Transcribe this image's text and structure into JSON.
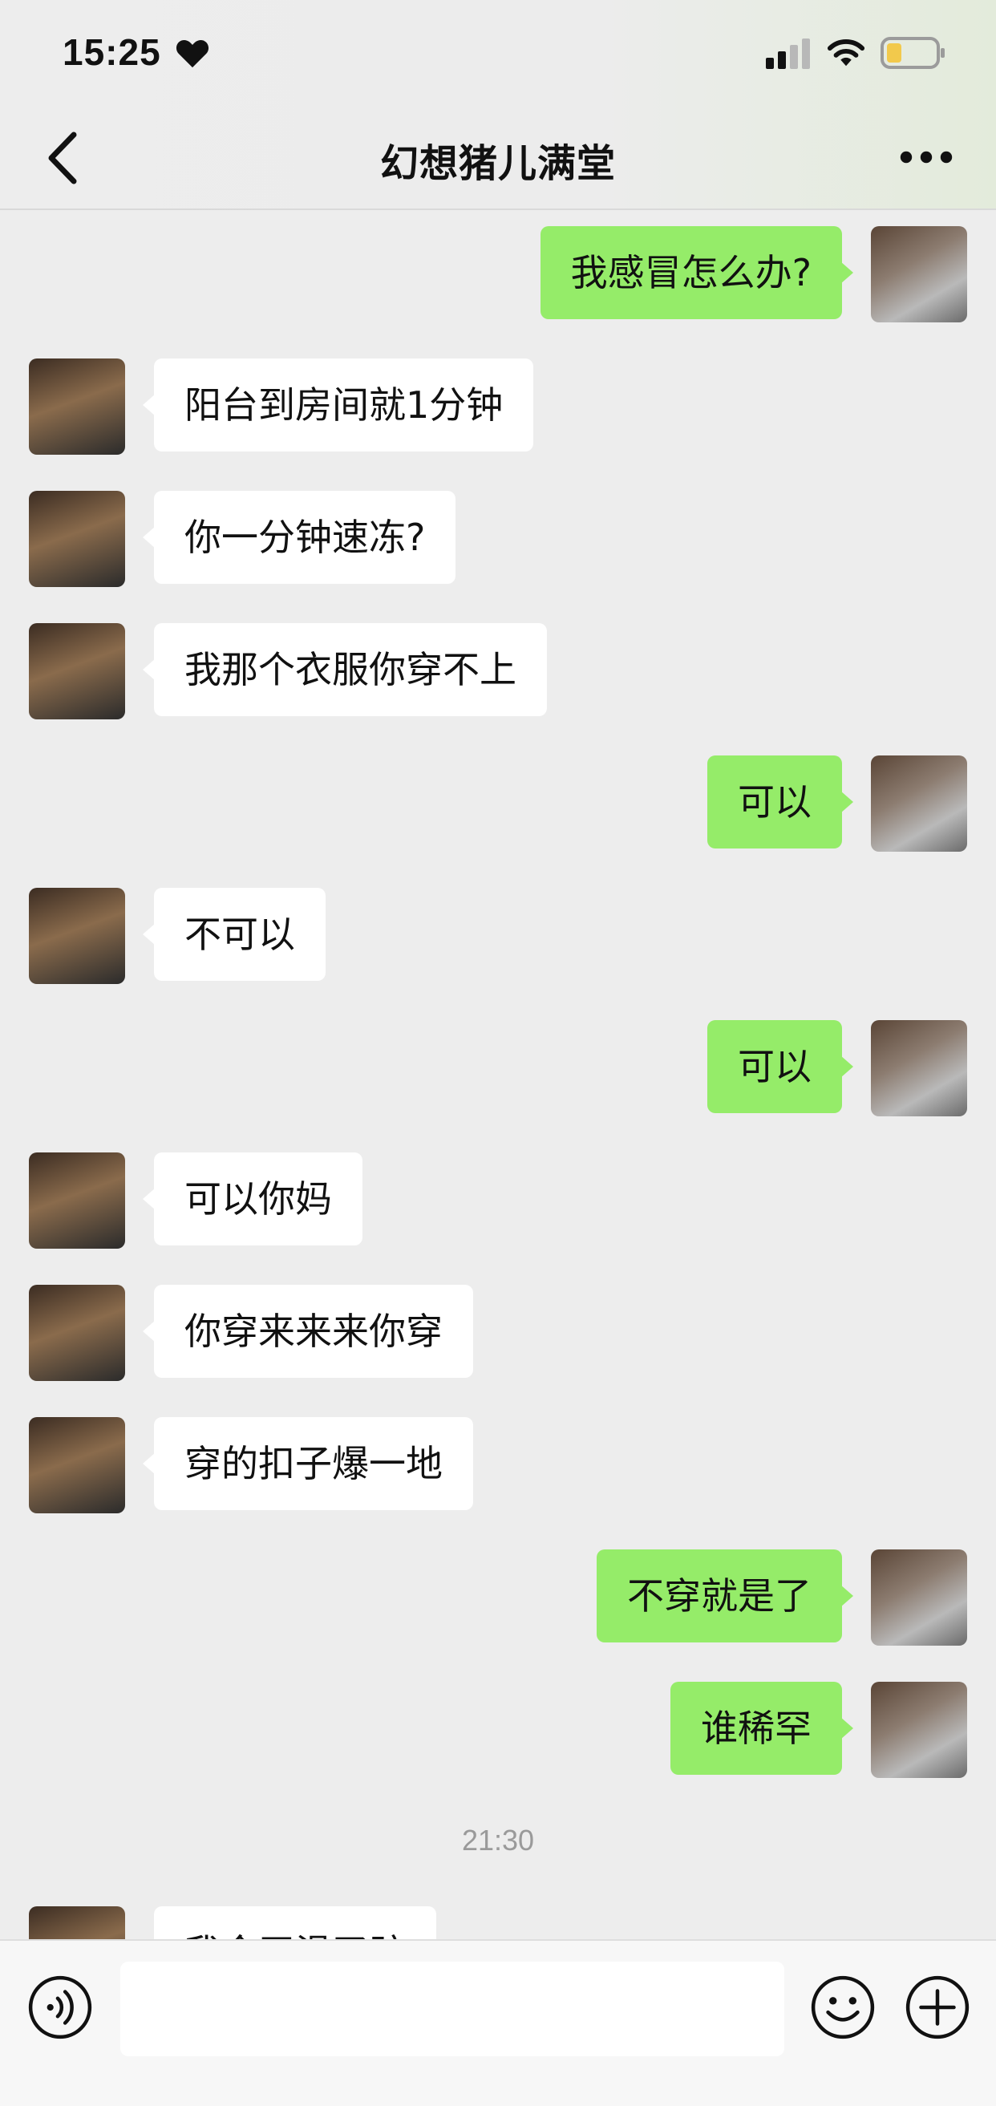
{
  "status_bar": {
    "time": "15:25",
    "icons": [
      "heart-icon",
      "signal-icon",
      "wifi-icon",
      "battery-icon"
    ]
  },
  "nav": {
    "title": "幻想猪儿满堂",
    "back_icon": "chevron-left-icon",
    "more_icon": "more-dots-icon"
  },
  "colors": {
    "background": "#ededed",
    "outgoing_bubble": "#95ec69",
    "incoming_bubble": "#ffffff",
    "timestamp_text": "#9a9a9a"
  },
  "messages": [
    {
      "side": "right",
      "text": "我感冒怎么办?"
    },
    {
      "side": "left",
      "text": "阳台到房间就1分钟"
    },
    {
      "side": "left",
      "text": "你一分钟速冻?"
    },
    {
      "side": "left",
      "text": "我那个衣服你穿不上"
    },
    {
      "side": "right",
      "text": "可以"
    },
    {
      "side": "left",
      "text": "不可以"
    },
    {
      "side": "right",
      "text": "可以"
    },
    {
      "side": "left",
      "text": "可以你妈"
    },
    {
      "side": "left",
      "text": "你穿来来来你穿"
    },
    {
      "side": "left",
      "text": "穿的扣子爆一地"
    },
    {
      "side": "right",
      "text": "不穿就是了"
    },
    {
      "side": "right",
      "text": "谁稀罕"
    },
    {
      "side": "left",
      "text": "我今天滑了跤"
    }
  ],
  "timestamp": "21:30",
  "input_bar": {
    "value": "",
    "placeholder": "",
    "icons": [
      "voice-icon",
      "emoji-icon",
      "plus-icon"
    ]
  }
}
